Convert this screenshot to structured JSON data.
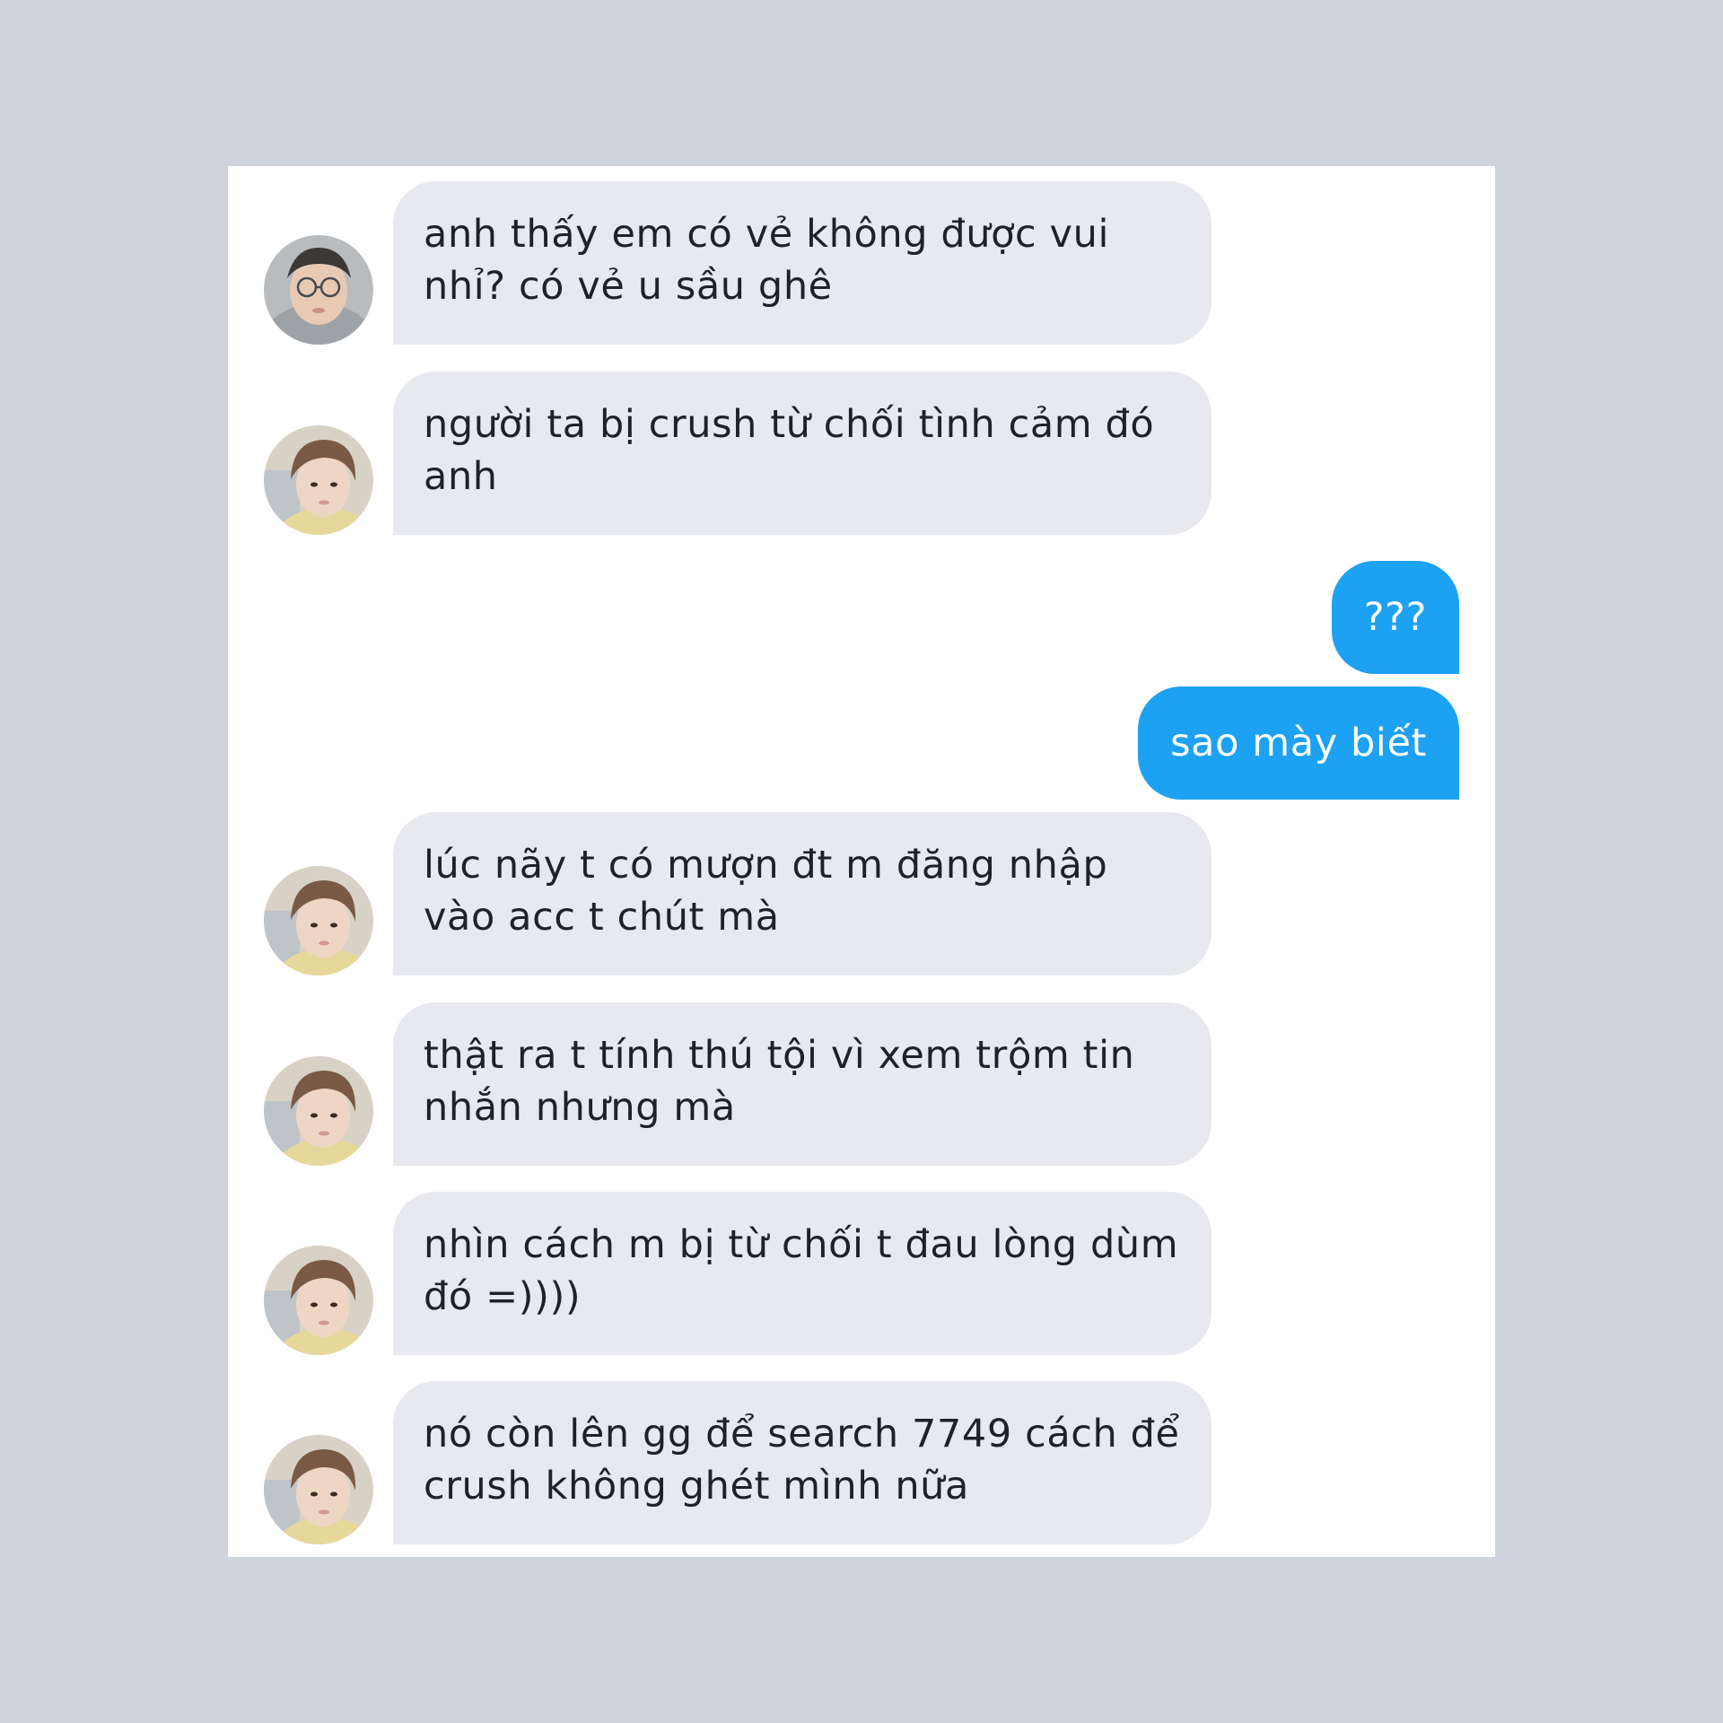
{
  "conversation": {
    "messages": [
      {
        "direction": "incoming",
        "avatar": "avatar-glasses-hoodie",
        "text": "anh thấy em có vẻ không được vui nhỉ? có vẻ u sầu ghê"
      },
      {
        "direction": "incoming",
        "avatar": "avatar-brown-hair",
        "text": "người ta bị crush từ chối tình cảm đó anh"
      },
      {
        "direction": "outgoing",
        "text": "???"
      },
      {
        "direction": "outgoing",
        "text": "sao mày biết"
      },
      {
        "direction": "incoming",
        "avatar": "avatar-brown-hair",
        "text": "lúc nãy t có mượn đt m đăng nhập vào acc t chút mà"
      },
      {
        "direction": "incoming",
        "avatar": "avatar-brown-hair",
        "text": "thật ra t tính thú tội vì xem trộm tin nhắn nhưng mà"
      },
      {
        "direction": "incoming",
        "avatar": "avatar-brown-hair",
        "text": "nhìn cách m bị từ chối t đau lòng dùm đó =))))"
      },
      {
        "direction": "incoming",
        "avatar": "avatar-brown-hair",
        "text": "nó còn lên gg để search 7749 cách để crush không ghét mình nữa"
      }
    ]
  },
  "colors": {
    "page_background": "#cfd3dc",
    "panel_background": "#ffffff",
    "incoming_bubble": "#e7e9ef",
    "incoming_text": "#1c2228",
    "outgoing_bubble": "#1da1f2",
    "outgoing_text": "#ffffff"
  }
}
